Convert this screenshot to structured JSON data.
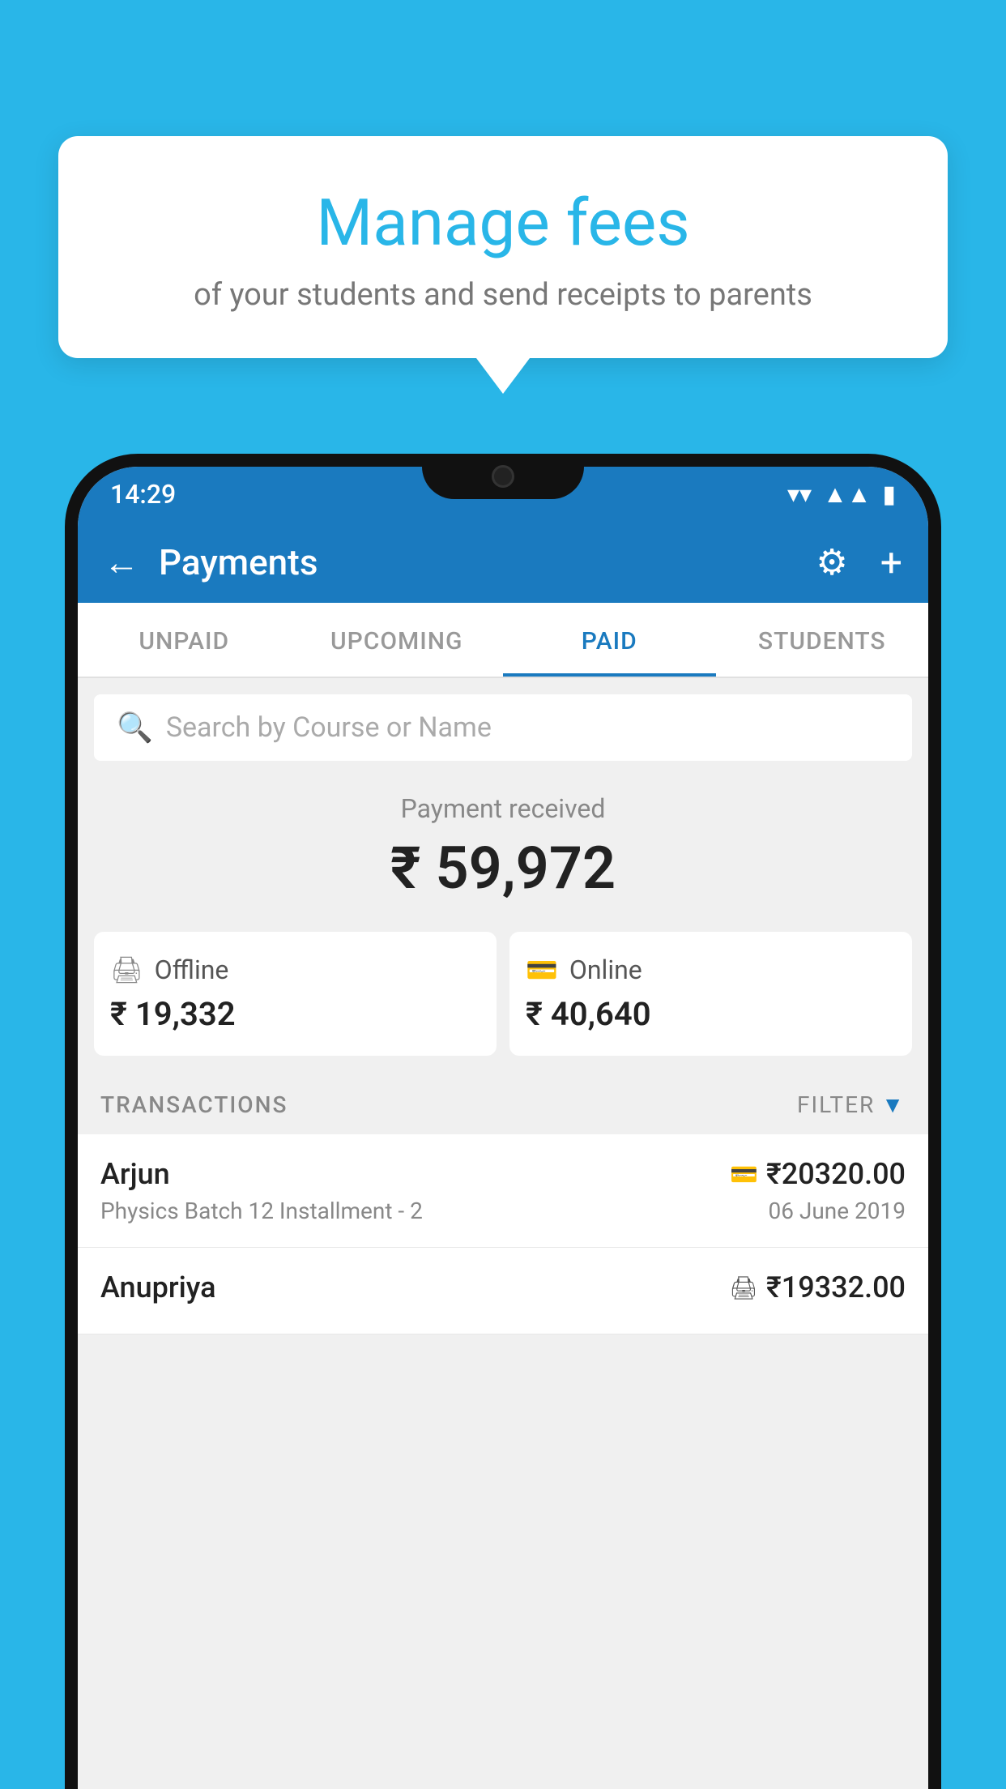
{
  "background_color": "#29b6e8",
  "tooltip": {
    "title": "Manage fees",
    "subtitle": "of your students and send receipts to parents"
  },
  "status_bar": {
    "time": "14:29",
    "wifi_icon": "▼",
    "signal_icon": "▲",
    "battery_icon": "▮"
  },
  "header": {
    "back_label": "←",
    "title": "Payments",
    "gear_label": "⚙",
    "plus_label": "+"
  },
  "tabs": [
    {
      "id": "unpaid",
      "label": "UNPAID",
      "active": false
    },
    {
      "id": "upcoming",
      "label": "UPCOMING",
      "active": false
    },
    {
      "id": "paid",
      "label": "PAID",
      "active": true
    },
    {
      "id": "students",
      "label": "STUDENTS",
      "active": false
    }
  ],
  "search": {
    "placeholder": "Search by Course or Name"
  },
  "payment_received": {
    "label": "Payment received",
    "amount": "₹ 59,972"
  },
  "payment_cards": [
    {
      "id": "offline",
      "icon": "🖨",
      "type": "Offline",
      "amount": "₹ 19,332"
    },
    {
      "id": "online",
      "icon": "💳",
      "type": "Online",
      "amount": "₹ 40,640"
    }
  ],
  "transactions": {
    "label": "TRANSACTIONS",
    "filter_label": "FILTER",
    "rows": [
      {
        "name": "Arjun",
        "icon": "💳",
        "amount": "₹20320.00",
        "course": "Physics Batch 12 Installment - 2",
        "date": "06 June 2019"
      },
      {
        "name": "Anupriya",
        "icon": "🖨",
        "amount": "₹19332.00",
        "course": "",
        "date": ""
      }
    ]
  }
}
